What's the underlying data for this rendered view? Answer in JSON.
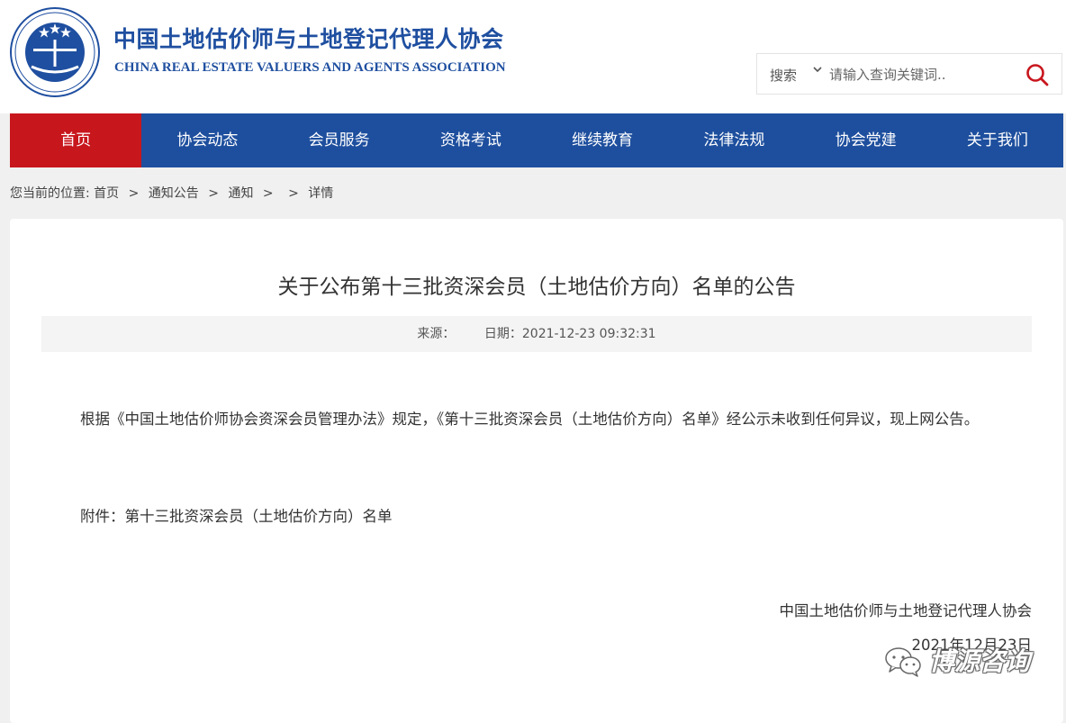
{
  "header": {
    "title_cn": "中国土地估价师与土地登记代理人协会",
    "title_en": "CHINA REAL ESTATE VALUERS AND AGENTS ASSOCIATION",
    "logo_text": "中国土地估价师与土地登记代理人协会 CHINA REAL ESTATE VALUERS AND AGENTS ASSOCIATION"
  },
  "search": {
    "type_label": "搜索",
    "placeholder": "请输入查询关键词.."
  },
  "nav": {
    "items": [
      {
        "label": "首页"
      },
      {
        "label": "协会动态"
      },
      {
        "label": "会员服务"
      },
      {
        "label": "资格考试"
      },
      {
        "label": "继续教育"
      },
      {
        "label": "法律法规"
      },
      {
        "label": "协会党建"
      },
      {
        "label": "关于我们"
      }
    ]
  },
  "breadcrumb": {
    "prefix": "您当前的位置:",
    "items": [
      "首页",
      "通知公告",
      "通知",
      "",
      "详情"
    ]
  },
  "article": {
    "title": "关于公布第十三批资深会员（土地估价方向）名单的公告",
    "source_label": "来源：",
    "date_label": "日期：2021-12-23 09:32:31",
    "para1": "根据《中国土地估价师协会资深会员管理办法》规定，《第十三批资深会员（土地估价方向）名单》经公示未收到任何异议，现上网公告。",
    "para2": "附件：第十三批资深会员（土地估价方向）名单",
    "sign_org": "中国土地估价师与土地登记代理人协会",
    "sign_date": "2021年12月23日"
  },
  "watermark": {
    "text": "博源咨询"
  },
  "colors": {
    "nav_blue": "#1e4f9e",
    "nav_active_red": "#c8161d",
    "title_blue": "#1f4fa0",
    "search_icon_red": "#c8161d"
  }
}
